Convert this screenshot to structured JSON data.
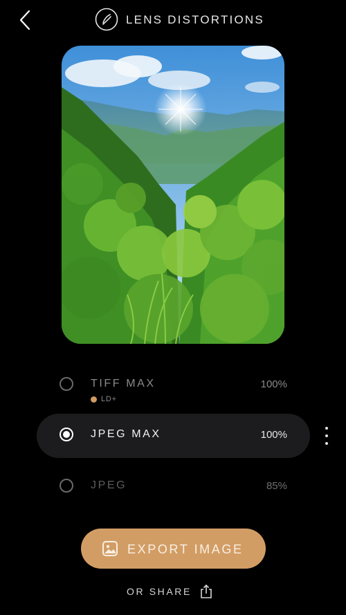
{
  "header": {
    "back_icon": "chevron-left-icon",
    "logo_icon": "lens-distortions-logo",
    "title": "LENS DISTORTIONS"
  },
  "preview": {
    "description_icon": "landscape-photo"
  },
  "export_options": [
    {
      "label": "TIFF MAX",
      "quality": "100%",
      "selected": false,
      "badge": "LD+",
      "badge_color": "#d09b63"
    },
    {
      "label": "JPEG MAX",
      "quality": "100%",
      "selected": true
    },
    {
      "label": "JPEG",
      "quality": "85%",
      "selected": false
    }
  ],
  "more_icon": "more-vertical-icon",
  "export": {
    "label": "EXPORT IMAGE",
    "icon": "image-icon",
    "color": "#d29d65"
  },
  "share": {
    "label": "OR SHARE",
    "icon": "share-icon"
  }
}
